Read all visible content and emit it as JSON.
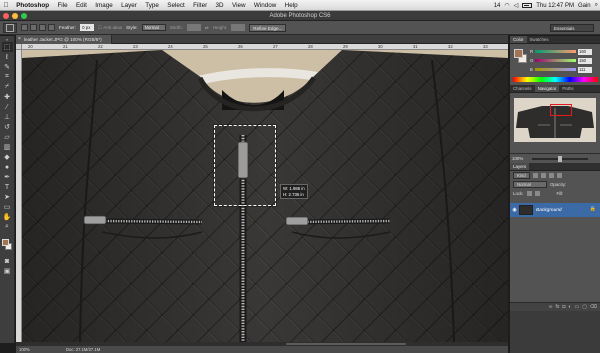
{
  "menubar": {
    "apple_glyph": "",
    "items": [
      "Photoshop",
      "File",
      "Edit",
      "Image",
      "Layer",
      "Type",
      "Select",
      "Filter",
      "3D",
      "View",
      "Window",
      "Help"
    ],
    "status": {
      "badge": "14",
      "time": "Thu 12:47 PM",
      "user": "Gain"
    }
  },
  "window": {
    "title": "Adobe Photoshop CS6"
  },
  "options": {
    "feather_label": "Feather:",
    "feather_value": "0 px",
    "antialias_label": "Anti-alias",
    "style_label": "Style:",
    "style_value": "Normal",
    "width_label": "Width:",
    "height_label": "Height:",
    "refine_label": "Refine Edge...",
    "workspace": "Essentials"
  },
  "tools": [
    "marquee",
    "lasso",
    "quick-select",
    "crop",
    "eyedropper",
    "healing",
    "brush",
    "clone-stamp",
    "history-brush",
    "eraser",
    "gradient",
    "blur",
    "dodge",
    "pen",
    "type",
    "path-select",
    "shape",
    "hand",
    "zoom"
  ],
  "colors": {
    "foreground": "#a27452",
    "background": "#f1ede6",
    "accent": "#3c6aa6"
  },
  "document": {
    "tab_title": "leather Jacket.JPG @ 100% (RGB/8*)",
    "ruler_labels": [
      "20",
      "21",
      "22",
      "23",
      "24",
      "25",
      "26",
      "27",
      "28",
      "29",
      "30",
      "31",
      "32",
      "33"
    ],
    "measure": {
      "width": "W: 1.986 in",
      "height": "H: 2.736 in"
    }
  },
  "status": {
    "zoom": "100%",
    "doc": "Doc: 27.1M/27.1M"
  },
  "panels": {
    "color_tabs": [
      "Color",
      "Swatches"
    ],
    "channels": [
      {
        "label": "R",
        "value": "160"
      },
      {
        "label": "G",
        "value": "150"
      },
      {
        "label": "B",
        "value": "111"
      }
    ],
    "nav_tabs": [
      "Channels",
      "Navigator",
      "Paths"
    ],
    "navigator_zoom": "100%",
    "layers_title": "Layers",
    "layers_kind": "Kind",
    "blend_mode": "Normal",
    "opacity_label": "Opacity:",
    "lock_label": "Lock:",
    "fill_label": "Fill:",
    "layer_name": "Background"
  }
}
